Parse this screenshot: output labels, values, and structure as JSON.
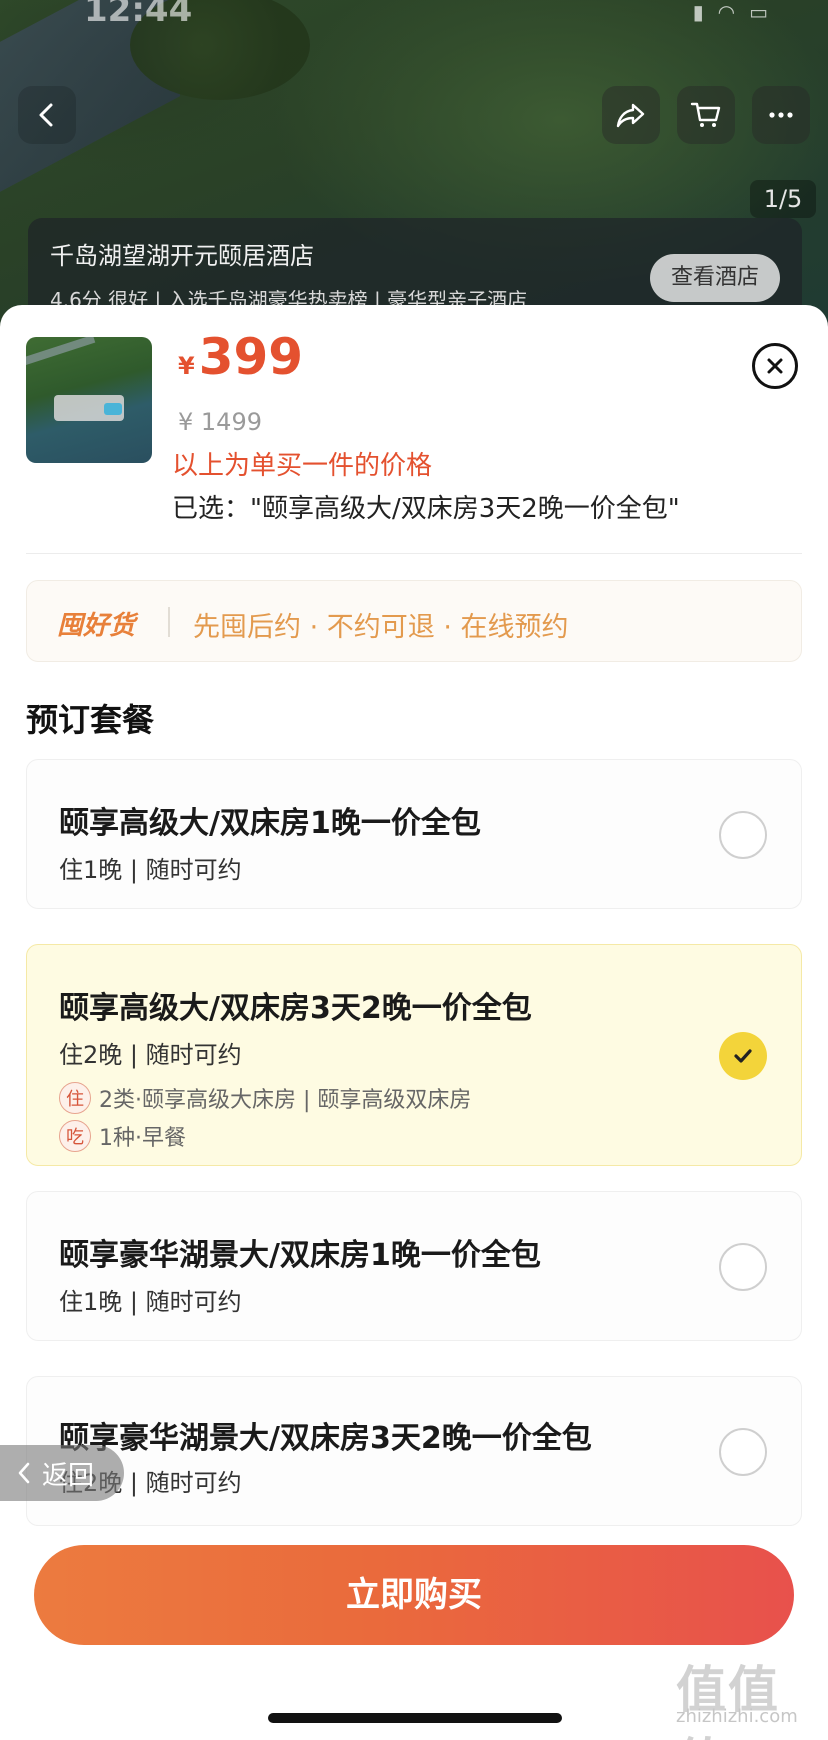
{
  "status": {
    "time": "12:44"
  },
  "gallery": {
    "counter": "1/5"
  },
  "hotel": {
    "name": "千岛湖望湖开元颐居酒店",
    "subtitle": "4.6分 很好 | 入选千岛湖豪华热卖榜 | 豪华型亲子酒店",
    "view_button": "查看酒店"
  },
  "sheet": {
    "currency": "¥",
    "price": "399",
    "original_price": "¥ 1499",
    "price_note": "以上为单买一件的价格",
    "selected_text": "已选：\"颐享高级大/双床房3天2晚一价全包\""
  },
  "promo": {
    "logo": "囤好货",
    "text": "先囤后约 · 不约可退 · 在线预约"
  },
  "section_title": "预订套餐",
  "packages": [
    {
      "title": "颐享高级大/双床房1晚一价全包",
      "sub": "住1晚 | 随时可约",
      "selected": false
    },
    {
      "title": "颐享高级大/双床房3天2晚一价全包",
      "sub": "住2晚 | 随时可约",
      "selected": true,
      "details": [
        {
          "tag": "住",
          "text": "2类·颐享高级大床房 | 颐享高级双床房"
        },
        {
          "tag": "吃",
          "text": "1种·早餐"
        }
      ]
    },
    {
      "title": "颐享豪华湖景大/双床房1晚一价全包",
      "sub": "住1晚 | 随时可约",
      "selected": false
    },
    {
      "title": "颐享豪华湖景大/双床房3天2晚一价全包",
      "sub": "住2晚 | 随时可约",
      "selected": false
    }
  ],
  "back_pill": "返回",
  "buy_button": "立即购买",
  "watermark": {
    "text": "值值值",
    "url": "zhizhizhi.com"
  },
  "colors": {
    "price": "#e4512f",
    "promo": "#e39a4e",
    "selected_bg": "#fefbe2",
    "check": "#f3d43a",
    "buy_start": "#ec7b3f",
    "buy_end": "#e8514c"
  }
}
